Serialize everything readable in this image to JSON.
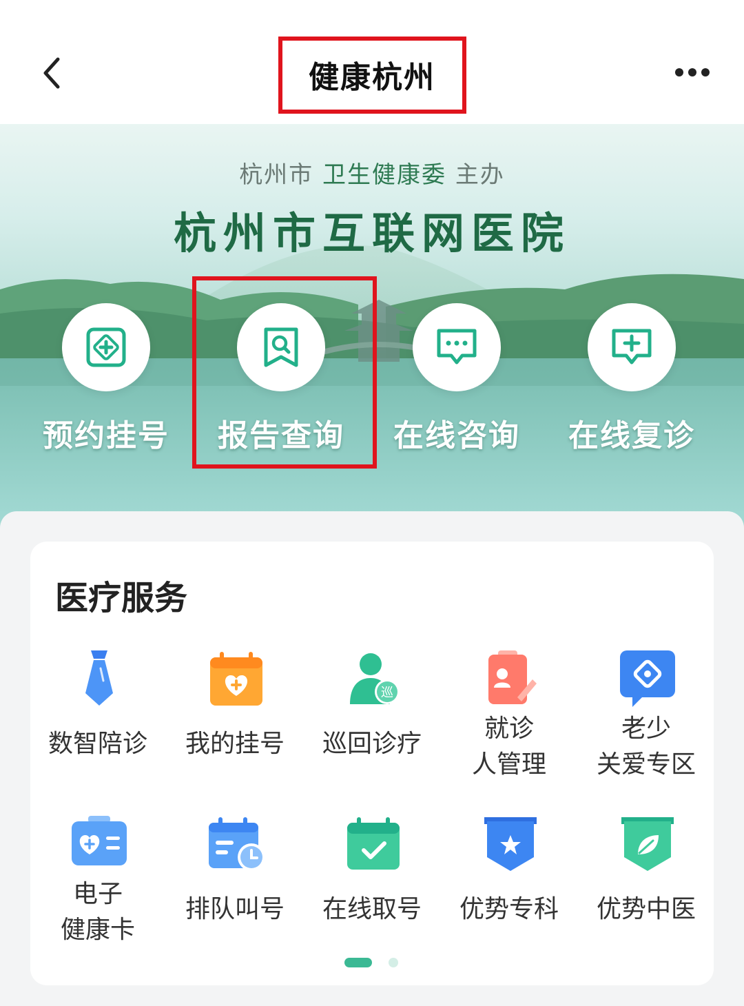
{
  "header": {
    "title": "健康杭州",
    "back_icon": "chevron-left-icon",
    "more_icon": "more-horizontal-icon"
  },
  "banner": {
    "sponsor_city": "杭州市",
    "sponsor_org": "卫生健康委",
    "sponsor_suffix": "主办",
    "hospital_name": "杭州市互联网医院",
    "quick_actions": [
      {
        "label": "预约挂号",
        "icon": "appointment-plus-icon"
      },
      {
        "label": "报告查询",
        "icon": "report-search-icon"
      },
      {
        "label": "在线咨询",
        "icon": "chat-bubble-icon"
      },
      {
        "label": "在线复诊",
        "icon": "chat-plus-icon"
      }
    ]
  },
  "services": {
    "title": "医疗服务",
    "items": [
      {
        "label": "数智陪诊",
        "icon": "necktie-icon"
      },
      {
        "label": "我的挂号",
        "icon": "calendar-plus-icon"
      },
      {
        "label": "巡回诊疗",
        "icon": "doctor-patrol-icon"
      },
      {
        "label_line1": "就诊",
        "label_line2": "人管理",
        "icon": "patient-file-icon"
      },
      {
        "label_line1": "老少",
        "label_line2": "关爱专区",
        "icon": "care-bubble-icon"
      },
      {
        "label_line1": "电子",
        "label_line2": "健康卡",
        "icon": "health-card-icon"
      },
      {
        "label": "排队叫号",
        "icon": "queue-calendar-icon"
      },
      {
        "label": "在线取号",
        "icon": "calendar-check-icon"
      },
      {
        "label": "优势专科",
        "icon": "star-badge-icon"
      },
      {
        "label": "优势中医",
        "icon": "leaf-badge-icon"
      }
    ],
    "page_count": 2,
    "current_page": 1
  },
  "colors": {
    "primary_green": "#3bb994",
    "highlight_red": "#e0141d",
    "hospital_name_green": "#1f6a45"
  }
}
